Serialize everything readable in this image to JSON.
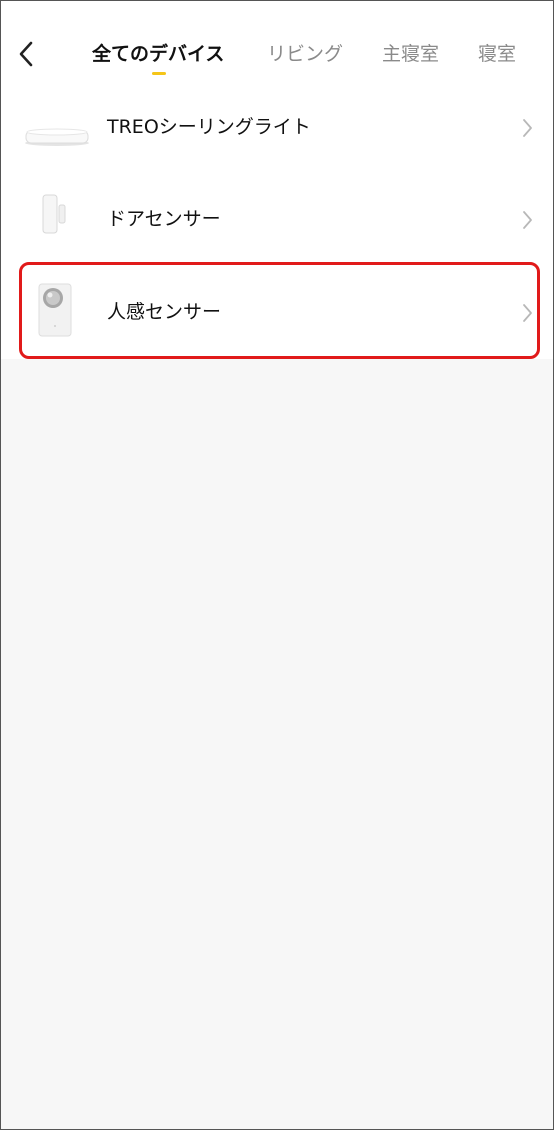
{
  "header": {
    "back_icon": "chevron-left-icon",
    "tabs": [
      {
        "label": "全てのデバイス",
        "active": true
      },
      {
        "label": "リビング",
        "active": false
      },
      {
        "label": "主寝室",
        "active": false
      },
      {
        "label": "寝室",
        "active": false
      }
    ]
  },
  "devices": [
    {
      "name": "TREOシーリングライト",
      "icon": "ceiling-light-icon"
    },
    {
      "name": "ドアセンサー",
      "icon": "door-sensor-icon"
    },
    {
      "name": "人感センサー",
      "icon": "motion-sensor-icon"
    }
  ],
  "colors": {
    "accent": "#f5c518",
    "highlight": "#e11a1a",
    "background": "#f7f7f7",
    "text": "#111111",
    "muted_text": "#8a8a8a"
  }
}
